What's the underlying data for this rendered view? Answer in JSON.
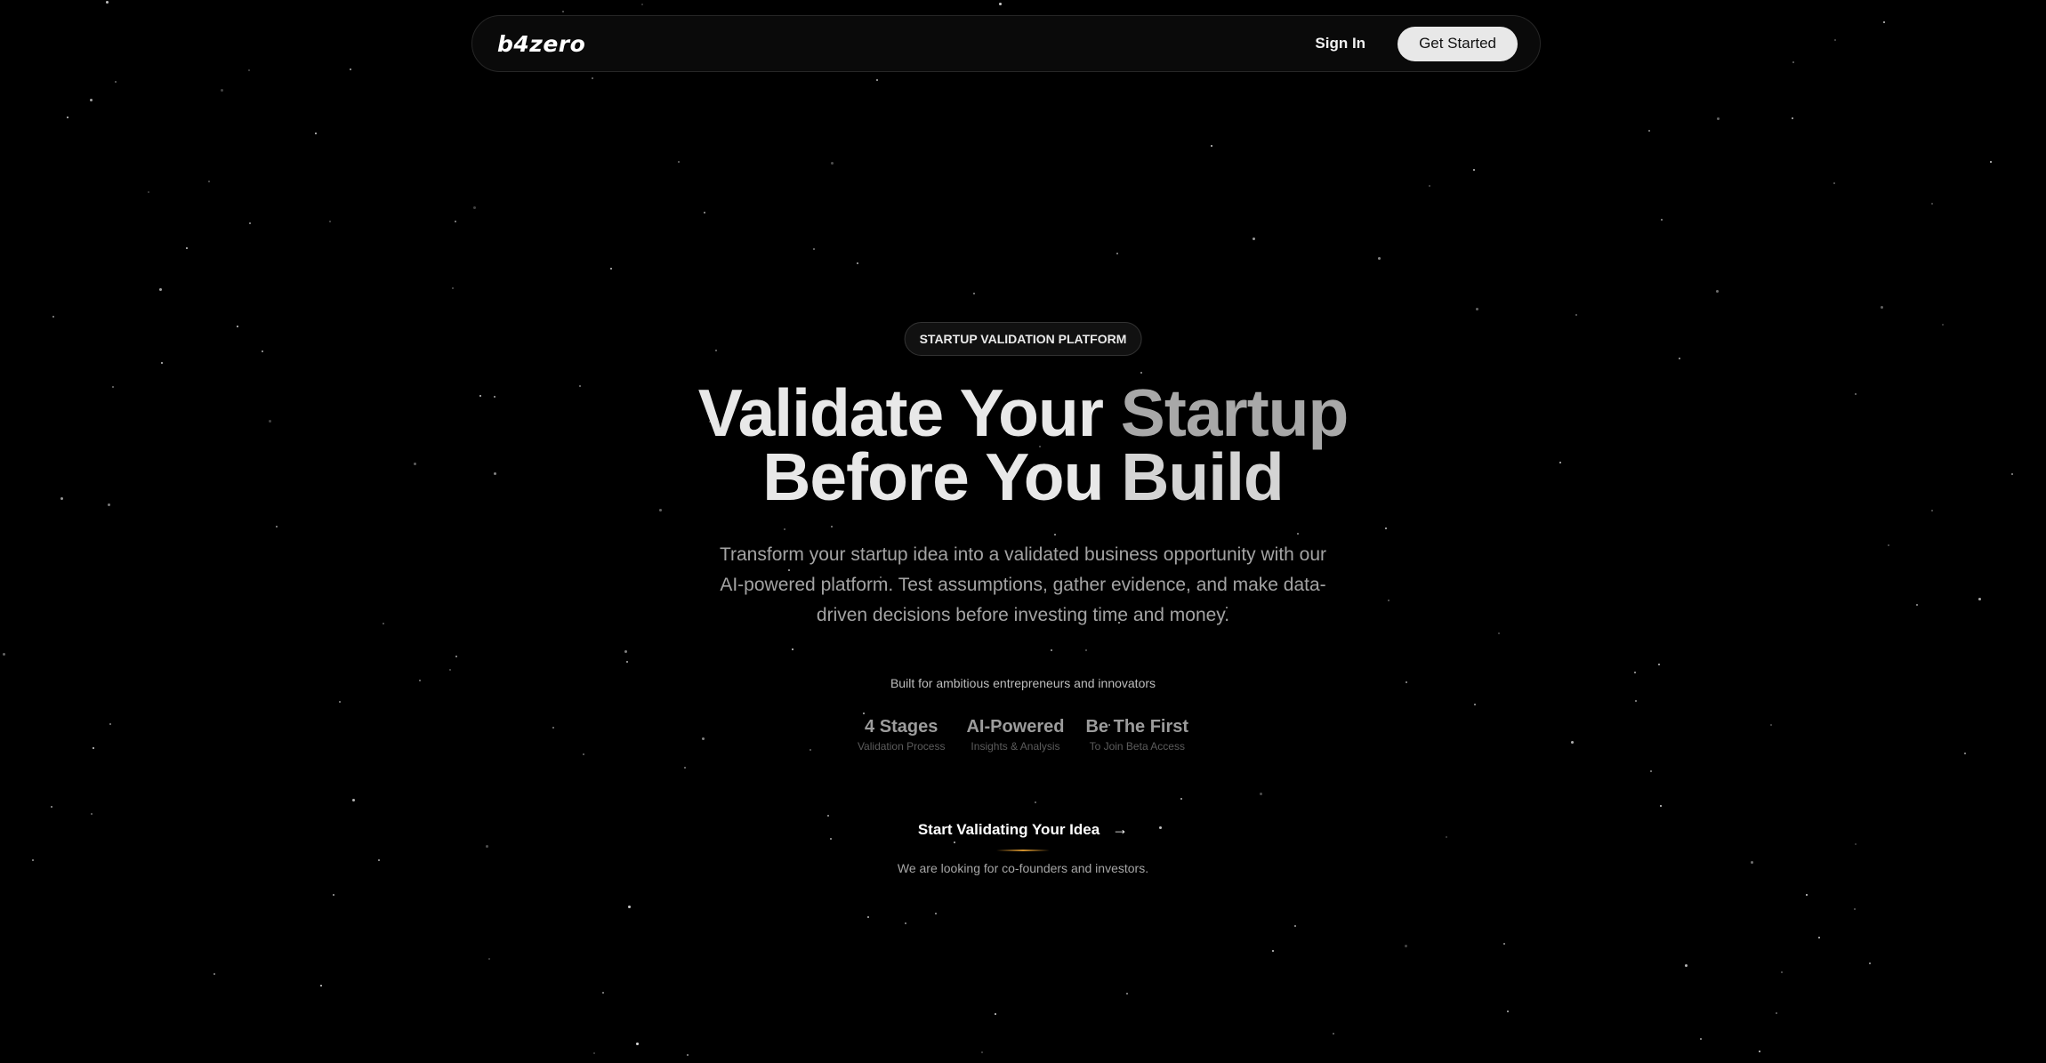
{
  "brand": {
    "logo_text": "b4zero"
  },
  "nav": {
    "sign_in_label": "Sign In",
    "get_started_label": "Get Started"
  },
  "hero": {
    "badge": "STARTUP VALIDATION PLATFORM",
    "headline": {
      "line1_part1": "Validate Your",
      "line1_part2": "Startup",
      "line2_part1": "Before You",
      "line2_part2": "Build"
    },
    "subtitle": "Transform your startup idea into a validated business opportunity with our AI-powered platform. Test assumptions, gather evidence, and make data-driven decisions before investing time and money.",
    "built_for": "Built for ambitious entrepreneurs and innovators",
    "stats": [
      {
        "value": "4 Stages",
        "label": "Validation Process"
      },
      {
        "value": "AI-Powered",
        "label": "Insights & Analysis"
      },
      {
        "value": "Be The First",
        "label": "To Join Beta Access"
      }
    ],
    "cta_label": "Start Validating Your Idea",
    "cta_icon": "arrow-right-icon",
    "looking_for": "We are looking for co-founders and investors."
  },
  "colors": {
    "background": "#000000",
    "accent_glow": "#e6a032",
    "button_bg": "#e8e8e8"
  }
}
